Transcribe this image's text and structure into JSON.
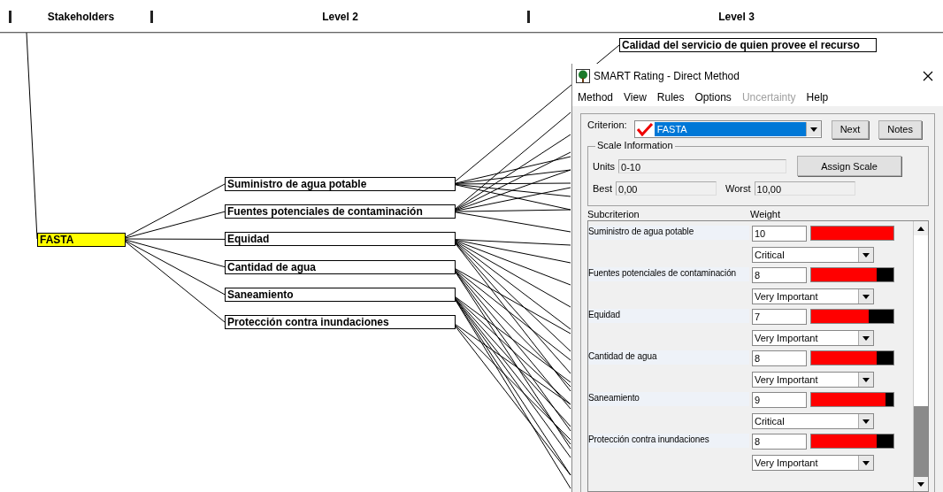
{
  "header": {
    "columns": [
      "Stakeholders",
      "Level 2",
      "Level 3"
    ]
  },
  "tree": {
    "label": "FASTA",
    "selected": true,
    "children": [
      {
        "label": "Suministro de agua potable",
        "selected": false,
        "children": [
          {
            "label": "Calidad del servicio de quien provee el recurso",
            "selected": false
          }
        ]
      },
      {
        "label": "Fuentes potenciales de contaminación",
        "selected": false
      },
      {
        "label": "Equidad",
        "selected": false
      },
      {
        "label": "Cantidad de agua",
        "selected": false
      },
      {
        "label": "Saneamiento",
        "selected": false
      },
      {
        "label": "Protección contra inundaciones",
        "selected": false
      }
    ]
  },
  "dialog": {
    "title": "SMART Rating - Direct Method",
    "menu": [
      {
        "label": "Method",
        "disabled": false
      },
      {
        "label": "View",
        "disabled": false
      },
      {
        "label": "Rules",
        "disabled": false
      },
      {
        "label": "Options",
        "disabled": false
      },
      {
        "label": "Uncertainty",
        "disabled": true
      },
      {
        "label": "Help",
        "disabled": false
      }
    ],
    "criterion": {
      "label": "Criterion:",
      "value": "FASTA"
    },
    "buttons": [
      "Next",
      "Notes"
    ],
    "scale": {
      "title": "Scale Information",
      "units_label": "Units",
      "units": "0-10",
      "assign_button": "Assign Scale",
      "best_label": "Best",
      "best": "0,00",
      "worst_label": "Worst",
      "worst": "10,00"
    },
    "columns": [
      "Subcriterion",
      "Weight"
    ],
    "subcriteria": [
      {
        "name": "Suministro de agua potable",
        "weight": "10",
        "level": 1.0,
        "importance": "Critical"
      },
      {
        "name": "Fuentes potenciales de contaminación",
        "weight": "8",
        "level": 0.8,
        "importance": "Very Important"
      },
      {
        "name": "Equidad",
        "weight": "7",
        "level": 0.7,
        "importance": "Very Important"
      },
      {
        "name": "Cantidad de agua",
        "weight": "8",
        "level": 0.8,
        "importance": "Very Important"
      },
      {
        "name": "Saneamiento",
        "weight": "9",
        "level": 0.9,
        "importance": "Critical"
      },
      {
        "name": "Protección contra inundaciones",
        "weight": "8",
        "level": 0.8,
        "importance": "Very Important"
      }
    ]
  }
}
